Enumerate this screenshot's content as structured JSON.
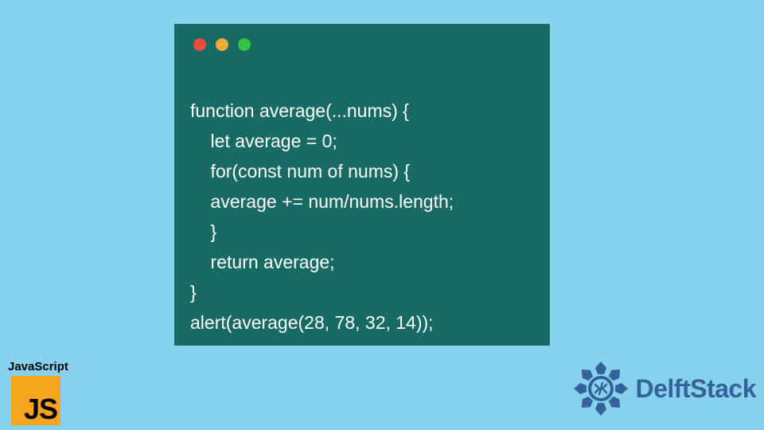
{
  "code": {
    "lines": [
      "function average(...nums) {",
      "    let average = 0;",
      "    for(const num of nums) {",
      "    average += num/nums.length;",
      "    }",
      "    return average;",
      "}",
      "alert(average(28, 78, 32, 14));"
    ]
  },
  "js_logo": {
    "label": "JavaScript",
    "letters": "JS"
  },
  "delft": {
    "text": "DelftStack"
  },
  "colors": {
    "background": "#86d1ee",
    "window": "#176b64",
    "js_square": "#f7a41d",
    "delft_blue": "#34639a"
  }
}
